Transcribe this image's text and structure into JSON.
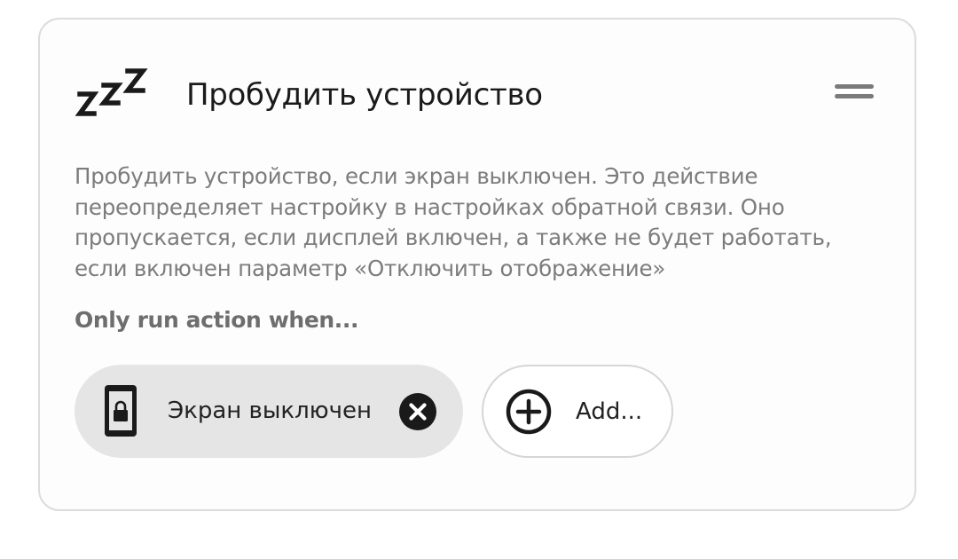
{
  "action_card": {
    "icon": "zzz-sleep-icon",
    "title": "Пробудить устройство",
    "drag_handle_icon": "drag-handle-icon",
    "description": "Пробудить устройство, если экран выключен. Это действие переопределяет настройку в настройках обратной связи. Оно пропускается, если дисплей включен, а также не будет работать, если включен параметр «Отключить отображение»",
    "conditions_heading": "Only run action when...",
    "conditions": [
      {
        "icon": "phone-lock-icon",
        "label": "Экран выключен",
        "remove_icon": "close-circle-icon"
      }
    ],
    "add_button": {
      "icon": "plus-circle-icon",
      "label": "Add..."
    }
  },
  "colors": {
    "card_border": "#dcdcdc",
    "chip_background": "#e5e5e5",
    "description_text": "#7c7c7c",
    "title_text": "#1a1a1a"
  }
}
